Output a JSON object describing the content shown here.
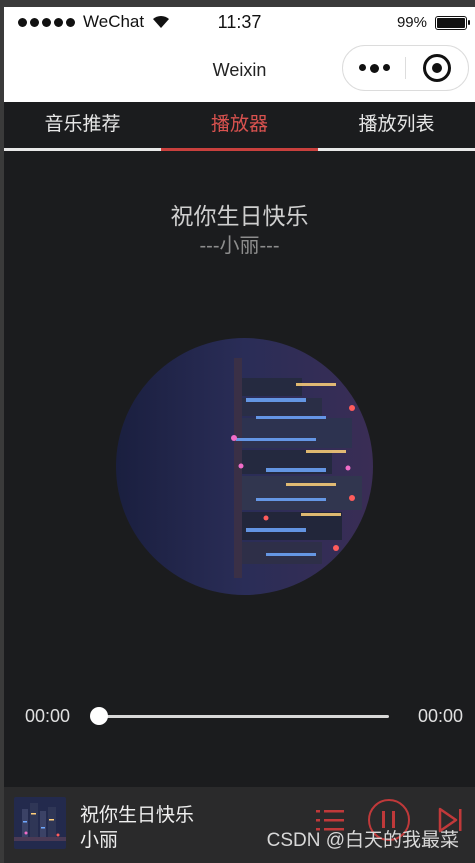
{
  "status_bar": {
    "carrier": "WeChat",
    "time": "11:37",
    "battery": "99%",
    "battery_level": 0.99
  },
  "nav": {
    "title": "Weixin"
  },
  "tabs": [
    {
      "label": "音乐推荐",
      "active": false
    },
    {
      "label": "播放器",
      "active": true
    },
    {
      "label": "播放列表",
      "active": false
    }
  ],
  "player": {
    "song_title": "祝你生日快乐",
    "artist_display": "---小丽---",
    "current_time": "00:00",
    "total_time": "00:00",
    "progress": 0
  },
  "mini_player": {
    "title": "祝你生日快乐",
    "artist": "小丽",
    "controls": [
      "playlist-icon",
      "pause-icon",
      "next-icon"
    ]
  },
  "watermark": "CSDN @白天的我最菜",
  "colors": {
    "accent": "#c9403d",
    "background": "#1b1c1e",
    "mini_bar": "#2a2a2b"
  }
}
